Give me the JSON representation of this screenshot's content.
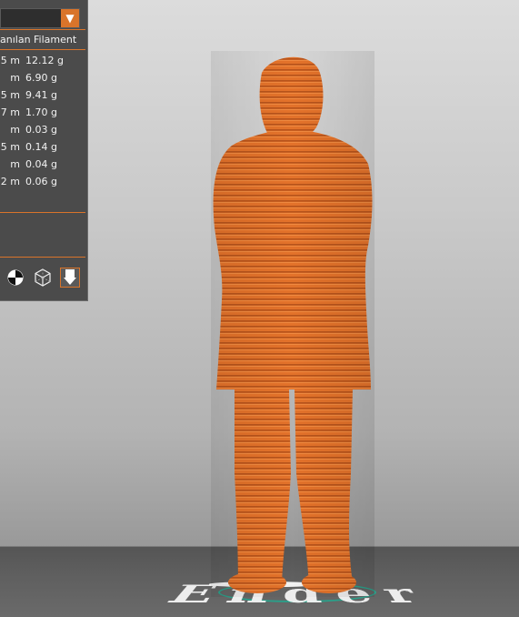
{
  "panel": {
    "dropdown_arrow": "▼",
    "column_header": "anılan Filament",
    "rows": [
      {
        "length": "5 m",
        "weight": "12.12 g"
      },
      {
        "length": "m",
        "weight": "6.90 g"
      },
      {
        "length": "5 m",
        "weight": "9.41 g"
      },
      {
        "length": "7 m",
        "weight": "1.70 g"
      },
      {
        "length": "m",
        "weight": "0.03 g"
      },
      {
        "length": "5 m",
        "weight": "0.14 g"
      },
      {
        "length": "m",
        "weight": "0.04 g"
      },
      {
        "length": "2 m",
        "weight": "0.06 g"
      }
    ],
    "tools": [
      "color-scheme-icon",
      "x-ray-view-icon",
      "layer-view-icon"
    ]
  },
  "scene": {
    "bed_logo": "Ender",
    "model_color": "#e3722a"
  },
  "colors": {
    "accent": "#d9742a",
    "panel": "#4b4b4b"
  }
}
